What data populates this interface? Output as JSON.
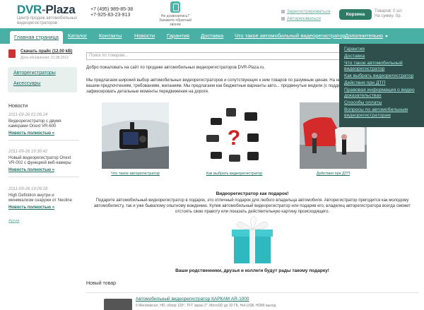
{
  "header": {
    "logo_main": "DVR",
    "logo_dash": "-",
    "logo_plaza": "Plaza",
    "logo_sub": "Центр продаж автомобильных видеорегистраторов",
    "phone1": "+7 (495) 989-85-38",
    "phone2": "+7-925-83-23-913",
    "callback_text": "Не дозвонились? Закажите обратный звонок",
    "register_link": "Зарегистрироваться",
    "login_link": "Авторизоваться",
    "cart_button": "Корзина",
    "cart_count": "Товаров: 0 шт.",
    "cart_sum": "На сумму: 0р."
  },
  "nav": {
    "items": [
      "Главная страница",
      "Каталог",
      "Контакты",
      "Новости",
      "Гарантия",
      "Доставка",
      "Что такое автомобильный видеорегистратор",
      "Дополнительно"
    ]
  },
  "dropdown": {
    "items": [
      "Гарантия",
      "Доставка",
      "Что такое автомобильный видеорегистратор",
      "Как выбрать видеорегистратор",
      "Действия при ДТП",
      "Правовая информация о видео доказательствах",
      "Способы оплаты",
      "Вопросы по автомобильным видеорегистраторам"
    ]
  },
  "sidebar": {
    "price_title": "Скачать прайс",
    "price_size": "(12.00 kB)",
    "price_date": "Дата обновления: 21.08.2012",
    "categories": [
      "Авторегистраторы",
      "Аксессуары"
    ],
    "news_heading": "Новости",
    "news": [
      {
        "date": "2011-09-26 01:06:24",
        "text": "Видеорегистратор с двумя камерами Onext VR-600",
        "more": "Новость полностью »"
      },
      {
        "date": "2011-09-26 19:30:42",
        "text": "Новый видеорегистратор Onext VR-002 с функцией веб-камеры",
        "more": "Новость полностью »"
      },
      {
        "date": "2011-09-26 19:09:28",
        "text": "High Definition внутри и минимализм снаружи от Neoline",
        "more": "Новость полностью »"
      }
    ],
    "archive": "Архив"
  },
  "main": {
    "search_placeholder": "Поиск по товарам...",
    "welcome": "Добро пожаловать на сайт по продаже автомобильных видеорегистраторов DVR-Plaza.ru.",
    "intro": "Мы предлагаем широкий выбор автомобильных видеорегистраторов и сопутствующих к ним товаров по разумным ценам. На наш... видеорегистратор отвечающий вашим предпочтениям, требованиям, желаниям. Мы предлагаем как бюджетные варианты авто... продвинутые модели (с поддержкой Full HD), способные зафиксировать детальные моменты передвижения на дороге.",
    "thumbs": [
      "Что такое авторегистратор",
      "Как выбрать видеорегистратор",
      "Действия при ДТП"
    ],
    "gift_heading": "Видеорегистратор как подарок!",
    "gift_text": "Подарите автомобильный видеорегистратор в подарок, это отличный подарок для любого владельца автомобиля. Авторегистратор пригодится как молодому автомобилисту, так и уже бывалому опытному вождению. Купив автомобильный видеорегистратор или подарив его, владелец авторегистратора всегда сможет отстоять свою правоту или показать действительную картину происходящего.",
    "gift_caption": "Ваши родственники, друзья и коллеги будут рады такому подарку!",
    "new_heading": "Новый товар",
    "product_title": "Автомобильный видеорегистратор КАРКАМ AR-1000",
    "product_desc": "5 Мегапиксел, HD, обзор 120°, TFT экран 2\", MicroSD до 32 ГБ, HeLUSB, HDMI выход"
  },
  "colors": {
    "nav_bg": "#4ab0a6",
    "dropdown_bg": "#2f4f4d",
    "accent": "#1a6b60",
    "cart_btn": "#2d7a65"
  }
}
